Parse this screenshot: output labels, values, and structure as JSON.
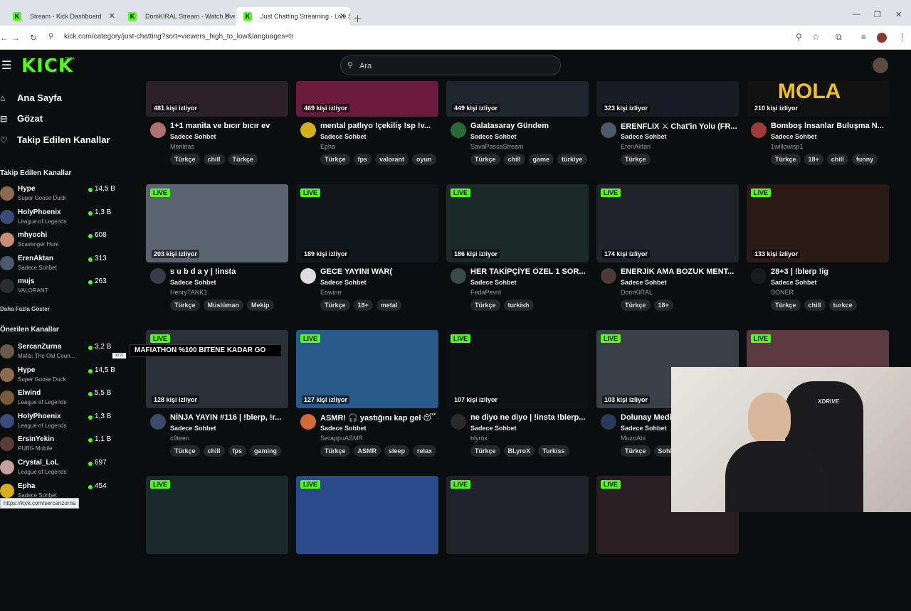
{
  "browser": {
    "tabs": [
      {
        "title": "Stream - Kick Dashboard",
        "active": false
      },
      {
        "title": "DomKIRAL Stream - Watch Live",
        "active": false
      },
      {
        "title": "Just Chatting Streaming - Live S",
        "active": true
      }
    ],
    "url": "kick.com/category/just-chatting?sort=viewers_high_to_low&languages=tr",
    "status_url": "https://kick.com/sercanzurna"
  },
  "header": {
    "logo": "KICK",
    "beta": "BETA",
    "search_placeholder": "Ara"
  },
  "sidebar": {
    "nav": [
      {
        "label": "Ana Sayfa",
        "icon": "home-icon"
      },
      {
        "label": "Gözat",
        "icon": "browse-icon"
      },
      {
        "label": "Takip Edilen Kanallar",
        "icon": "heart-icon"
      }
    ],
    "followed_title": "Takip Edilen Kanallar",
    "followed": [
      {
        "name": "Hype",
        "category": "Super Goose Duck",
        "viewers": "14,5 B",
        "color": "#8e6b4f"
      },
      {
        "name": "HolyPhoenix",
        "category": "League of Legends",
        "viewers": "1,3 B",
        "color": "#3b4a7a"
      },
      {
        "name": "mhyochi",
        "category": "Scavenger Hunt",
        "viewers": "608",
        "color": "#c98c7a"
      },
      {
        "name": "ErenAktan",
        "category": "Sadece Sohbet",
        "viewers": "313",
        "color": "#4a5a6a"
      },
      {
        "name": "mujs",
        "category": "VALORANT",
        "viewers": "263",
        "color": "#2c2c2c"
      }
    ],
    "show_more": "Daha Fazla Göster",
    "recommended_title": "Önerilen Kanallar",
    "recommended": [
      {
        "name": "SercanZurna",
        "category": "Mafia: The Old Coun...",
        "viewers": "3,2 B",
        "color": "#6a5a4a"
      },
      {
        "name": "Hype",
        "category": "Super Goose Duck",
        "viewers": "14,5 B",
        "color": "#8e6b4f"
      },
      {
        "name": "Elwind",
        "category": "League of Legends",
        "viewers": "5,5 B",
        "color": "#7a5a3a"
      },
      {
        "name": "HolyPhoenix",
        "category": "League of Legends",
        "viewers": "1,3 B",
        "color": "#3b4a7a"
      },
      {
        "name": "ErsinYekin",
        "category": "PUBG Mobile",
        "viewers": "1,1 B",
        "color": "#5a3a3a"
      },
      {
        "name": "Crystal_LoL",
        "category": "League of Legends",
        "viewers": "697",
        "color": "#c9a0a0"
      },
      {
        "name": "Epha",
        "category": "Sadece Sohbet",
        "viewers": "454",
        "color": "#d4b020"
      }
    ],
    "tooltip": "MAFIATHON  %100 BITENE KADAR GO",
    "tooltip_small": "3221"
  },
  "streams": [
    {
      "viewers": "481 kişi izliyor",
      "title": "1+1 manita ve bıcır bıcır ev",
      "category": "Sadece Sohbet",
      "user": "Merilnas",
      "tags": [
        "Türkçe",
        "chill",
        "Türkçe"
      ],
      "live": false,
      "thumb": "#2a2228",
      "avatar": "#b07070"
    },
    {
      "viewers": "469 kişi izliyor",
      "title": "mental patlıyo !çekiliş !sp !v...",
      "category": "Sadece Sohbet",
      "user": "Epha",
      "tags": [
        "Türkçe",
        "fps",
        "valorant",
        "oyun"
      ],
      "live": false,
      "thumb": "#6a1a3a",
      "avatar": "#d4b020"
    },
    {
      "viewers": "449 kişi izliyor",
      "title": "Galatasaray Gündem",
      "category": "Sadece Sohbet",
      "user": "SavaPassaStream",
      "tags": [
        "Türkçe",
        "chill",
        "game",
        "türkiye"
      ],
      "live": false,
      "thumb": "#1e2630",
      "avatar": "#2a6a3a"
    },
    {
      "viewers": "323 kişi izliyor",
      "title": "ERENFLIX ⚔ Chat'in Yolu (FR...",
      "category": "Sadece Sohbet",
      "user": "ErenAktan",
      "tags": [
        "Türkçe"
      ],
      "live": false,
      "thumb": "#1a1c24",
      "avatar": "#4a5a6a"
    },
    {
      "viewers": "210 kişi izliyor",
      "title": "Bomboş İnsanlar Buluşma N...",
      "category": "Sadece Sohbet",
      "user": "1willowisp1",
      "tags": [
        "Türkçe",
        "18+",
        "chill",
        "funny"
      ],
      "live": false,
      "thumb": "#121212",
      "avatar": "#a03a3a",
      "overlay": "MOLA"
    },
    {
      "viewers": "203 kişi izliyor",
      "title": "s u b d a y | !insta",
      "category": "Sadece Sohbet",
      "user": "HenryTANK1",
      "tags": [
        "Türkçe",
        "Müslüman",
        "Mekip"
      ],
      "live": true,
      "thumb": "#5a6470",
      "avatar": "#3a3a4a"
    },
    {
      "viewers": "189 kişi izliyor",
      "title": "GECE YAYINI WAR(",
      "category": "Sadece Sohbet",
      "user": "Eowinn",
      "tags": [
        "Türkçe",
        "18+",
        "metal"
      ],
      "live": true,
      "thumb": "#10161a",
      "avatar": "#dddddd"
    },
    {
      "viewers": "186 kişi izliyor",
      "title": "HER TAKİPÇİYE ÖZEL 1 SOR...",
      "category": "Sadece Sohbet",
      "user": "FedaPevril",
      "tags": [
        "Türkçe",
        "turkish"
      ],
      "live": true,
      "thumb": "#1a2a28",
      "avatar": "#3a4a4a"
    },
    {
      "viewers": "174 kişi izliyor",
      "title": "ENERJİK AMA BOZUK MENT...",
      "category": "Sadece Sohbet",
      "user": "DomKIRAL",
      "tags": [
        "Türkçe",
        "18+"
      ],
      "live": true,
      "thumb": "#20232a",
      "avatar": "#4a3a3a"
    },
    {
      "viewers": "133 kişi izliyor",
      "title": "28+3 | !blerp !ig",
      "category": "Sadece Sohbet",
      "user": "SONER",
      "tags": [
        "Türkçe",
        "chill",
        "turkce"
      ],
      "live": true,
      "thumb": "#2a1c14",
      "avatar": "#1a1a1a"
    },
    {
      "viewers": "128 kişi izliyor",
      "title": "NİNJA YAYIN #116 | !blerp, !r...",
      "category": "Sadece Sohbet",
      "user": "c9teen",
      "tags": [
        "Türkçe",
        "chill",
        "fps",
        "gaming"
      ],
      "live": true,
      "thumb": "#2a3038",
      "avatar": "#3a4a6a"
    },
    {
      "viewers": "127 kişi izliyor",
      "title": "ASMR! 🎧 yastığını kap gel 😴 -",
      "category": "Sadece Sohbet",
      "user": "SerappuASMR",
      "tags": [
        "Türkçe",
        "ASMR",
        "sleep",
        "relax"
      ],
      "live": true,
      "thumb": "#2a5a8a",
      "avatar": "#d06a3a"
    },
    {
      "viewers": "107 kişi izliyor",
      "title": "ne diyo ne diyo | !insta !blerp...",
      "category": "Sadece Sohbet",
      "user": "blyrox",
      "tags": [
        "Türkçe",
        "BLyroX",
        "Turkiss"
      ],
      "live": true,
      "thumb": "#0e1214",
      "avatar": "#2a2a2a"
    },
    {
      "viewers": "103 kişi izliyor",
      "title": "Dolunay Medit",
      "category": "Sadece Sohbet",
      "user": "MuzoAbi",
      "tags": [
        "Türkçe",
        "Sohb"
      ],
      "live": true,
      "thumb": "#3a4048",
      "avatar": "#2a3a5a"
    },
    {
      "viewers": "",
      "title": "",
      "category": "",
      "user": "",
      "tags": [],
      "live": true,
      "thumb": "#5a3a40",
      "avatar": ""
    },
    {
      "viewers": "",
      "title": "",
      "category": "",
      "user": "",
      "tags": [],
      "live": true,
      "thumb": "#1a2a2a",
      "avatar": ""
    },
    {
      "viewers": "",
      "title": "",
      "category": "",
      "user": "",
      "tags": [],
      "live": true,
      "thumb": "#2a4a8a",
      "avatar": ""
    },
    {
      "viewers": "",
      "title": "",
      "category": "",
      "user": "",
      "tags": [],
      "live": true,
      "thumb": "#20232a",
      "avatar": ""
    },
    {
      "viewers": "",
      "title": "",
      "category": "",
      "user": "",
      "tags": [],
      "live": true,
      "thumb": "#2a2024",
      "avatar": ""
    }
  ],
  "webcam": {
    "chair_text": "XDRIVE"
  }
}
